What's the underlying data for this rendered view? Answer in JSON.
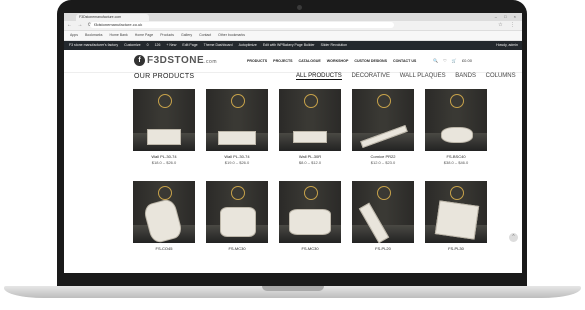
{
  "browser": {
    "tab_title": "F3Dstonemanufacture.com",
    "window_controls": "– □ ×",
    "url": "f3dstonemanufacture.co.uk",
    "nav_glyphs": "← → ⟳",
    "ext_glyphs": "☆ ⋮"
  },
  "bookmarks": [
    "Apps",
    "Bookmarks",
    "Home Bank",
    "Home Page",
    "Products",
    "Gallery",
    "Contact",
    "Other bookmarks"
  ],
  "wp_admin": {
    "items": [
      "F3 stone manufacturer's factory",
      "Customize",
      "0",
      "126",
      "+ New",
      "Edit Page",
      "Theme Dashboard",
      "Autoptimize",
      "Edit with WPBakery Page Builder",
      "Slider Revolution"
    ],
    "howdy": "Howdy, admin"
  },
  "site": {
    "logo_letter": "f",
    "logo_text": "F3DSTONE",
    "logo_suffix": ".com",
    "nav": [
      "PRODUCTS",
      "PROJECTS",
      "CATALOGUE",
      "WORKSHOP",
      "CUSTOM DESIGNS",
      "CONTACT US"
    ],
    "tools": [
      "🔍",
      "♡",
      "🛒",
      "£0.00"
    ]
  },
  "products": {
    "heading": "OUR PRODUCTS",
    "filters": [
      "ALL PRODUCTS",
      "DECORATIVE",
      "WALL PLAQUES",
      "BANDS",
      "COLUMNS"
    ],
    "active_filter": "ALL PRODUCTS",
    "items": [
      {
        "name": "Wall PL-30-74",
        "price": "$18.0 – $26.0"
      },
      {
        "name": "Wall PL-30-74",
        "price": "$19.0 – $26.0"
      },
      {
        "name": "Wall PL-30R",
        "price": "$8.0 – $12.0"
      },
      {
        "name": "Cornice PR22",
        "price": "$12.0 – $23.0"
      },
      {
        "name": "FS-BSC40",
        "price": "$38.0 – $46.0"
      },
      {
        "name": "FS-CO45",
        "price": ""
      },
      {
        "name": "FS-MC30",
        "price": ""
      },
      {
        "name": "FS-MC30",
        "price": ""
      },
      {
        "name": "FS-PL20",
        "price": ""
      },
      {
        "name": "FS-PL30",
        "price": ""
      }
    ]
  },
  "scroll_top_glyph": "⌃"
}
